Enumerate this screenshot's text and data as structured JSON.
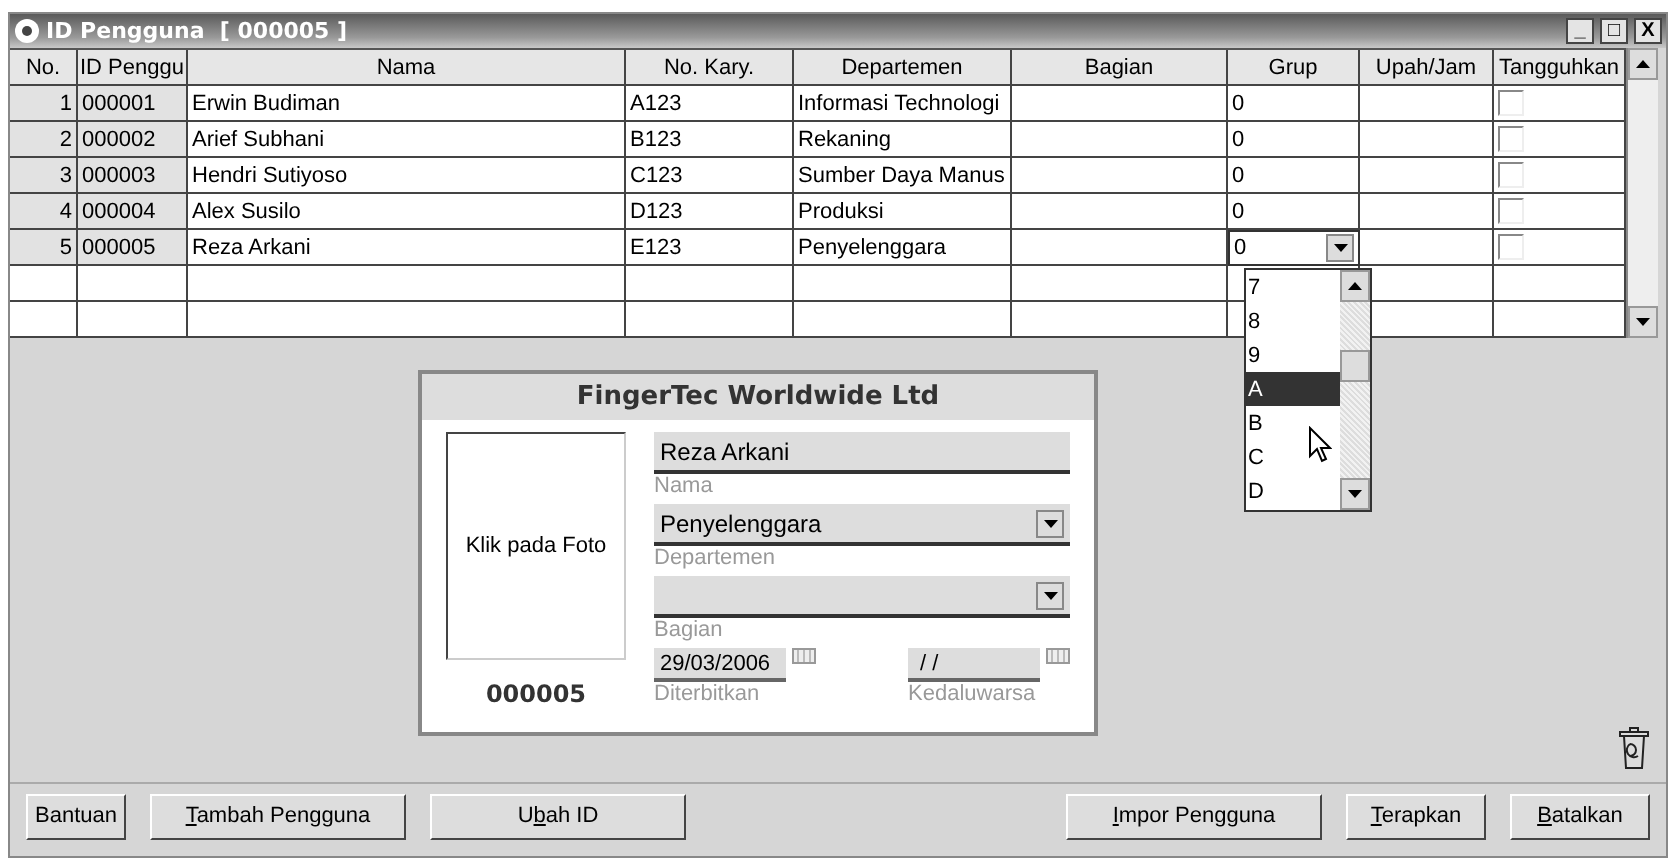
{
  "window": {
    "title": "ID Pengguna  [ 000005 ]",
    "controls": [
      "_",
      "□",
      "X"
    ]
  },
  "table": {
    "columns": [
      "No.",
      "ID Penggu",
      "Nama",
      "No. Kary.",
      "Departemen",
      "Bagian",
      "Grup",
      "Upah/Jam",
      "Tangguhkan"
    ],
    "rows": [
      {
        "no": "1",
        "id": "000001",
        "nama": "Erwin Budiman",
        "kary": "A123",
        "dept": "Informasi Technologi",
        "grup": "0",
        "suspended": false,
        "editing": false
      },
      {
        "no": "2",
        "id": "000002",
        "nama": "Arief Subhani",
        "kary": "B123",
        "dept": "Rekaning",
        "grup": "0",
        "suspended": false,
        "editing": false
      },
      {
        "no": "3",
        "id": "000003",
        "nama": "Hendri Sutiyoso",
        "kary": "C123",
        "dept": "Sumber Daya Manus",
        "grup": "0",
        "suspended": false,
        "editing": false
      },
      {
        "no": "4",
        "id": "000004",
        "nama": "Alex Susilo",
        "kary": "D123",
        "dept": "Produksi",
        "grup": "0",
        "suspended": false,
        "editing": false
      },
      {
        "no": "5",
        "id": "000005",
        "nama": "Reza Arkani",
        "kary": "E123",
        "dept": "Penyelenggara",
        "grup": "0",
        "suspended": false,
        "editing": true
      }
    ],
    "grup_options": [
      {
        "label": "7",
        "selected": false
      },
      {
        "label": "8",
        "selected": false
      },
      {
        "label": "9",
        "selected": false
      },
      {
        "label": "A",
        "selected": true
      },
      {
        "label": "B",
        "selected": false
      },
      {
        "label": "C",
        "selected": false
      },
      {
        "label": "D",
        "selected": false
      }
    ]
  },
  "card": {
    "company": "FingerTec Worldwide Ltd",
    "photo_label": "Klik pada Foto",
    "user_id": "000005",
    "nama": {
      "value": "Reza Arkani",
      "label": "Nama"
    },
    "departemen": {
      "value": "Penyelenggara",
      "label": "Departemen"
    },
    "bagian": {
      "label": "Bagian"
    },
    "diterbitkan": {
      "value": "29/03/2006",
      "label": "Diterbitkan"
    },
    "kedaluwarsa": {
      "value": " / /",
      "label": "Kedaluwarsa"
    }
  },
  "buttons": [
    "Bantuan",
    "Tambah Pengguna",
    "Ubah ID",
    "Impor Pengguna",
    "Terapkan",
    "Batalkan"
  ]
}
